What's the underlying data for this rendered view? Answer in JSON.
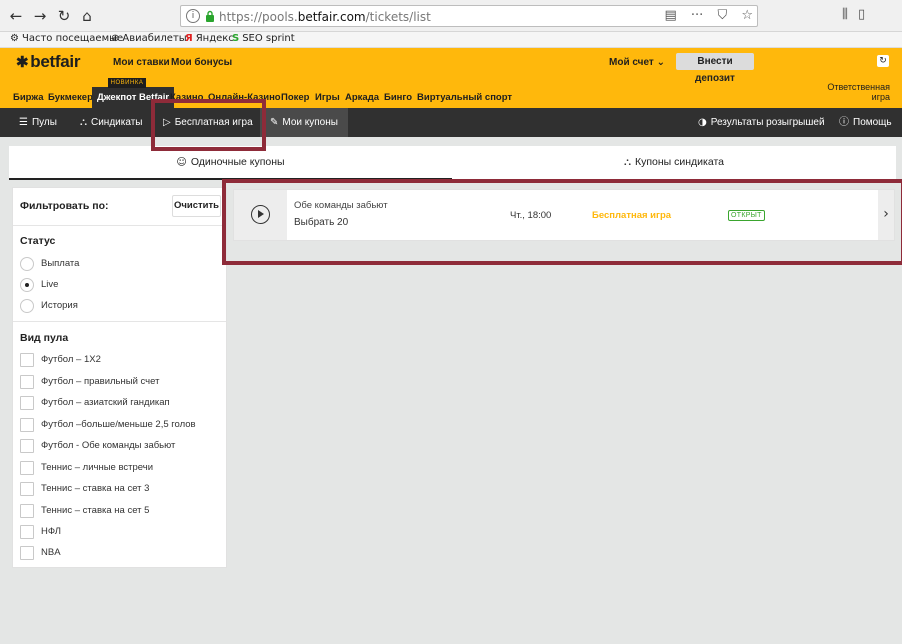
{
  "browser": {
    "url_prefix": "https://pools.",
    "url_domain": "betfair.com",
    "url_path": "/tickets/list",
    "bookmarks": [
      {
        "label": "Часто посещаемые",
        "icon": "gear-icon"
      },
      {
        "label": "Авиабилеты",
        "icon": "globe-icon"
      },
      {
        "label": "Яндекс",
        "icon": "yandex-icon"
      },
      {
        "label": "SEO sprint",
        "icon": "seo-icon"
      }
    ]
  },
  "header": {
    "logo": "betfair",
    "top_links": [
      "Мои ставки",
      "Мои бонусы"
    ],
    "account": "Мой счет",
    "deposit": "Внести депозит",
    "new_badge": "НОВИНКА",
    "responsible_line1": "Ответственная",
    "responsible_line2": "игра",
    "product_nav": [
      "Биржа",
      "Букмекер",
      "Джекпот Betfair",
      "Казино",
      "Онлайн-Казино",
      "Покер",
      "Игры",
      "Аркада",
      "Бинго",
      "Виртуальный спорт"
    ],
    "brand_color": "#ffb80c"
  },
  "subnav": {
    "pools": "Пулы",
    "syndicates": "Синдикаты",
    "free_game": "Бесплатная игра",
    "my_coupons": "Мои купоны",
    "results": "Результаты розыгрышей",
    "help": "Помощь"
  },
  "tabs": {
    "single": "Одиночные купоны",
    "syndicate": "Купоны синдиката"
  },
  "filter": {
    "title": "Фильтровать по:",
    "clear": "Очистить",
    "status_title": "Статус",
    "status_options": [
      "Выплата",
      "Live",
      "История"
    ],
    "status_selected": "Live",
    "pool_type_title": "Вид пула",
    "pool_types": [
      "Футбол – 1X2",
      "Футбол – правильный счет",
      "Футбол – азиатский гандикап",
      "Футбол –больше/меньше 2,5 голов",
      "Футбол - Обе команды забьют",
      "Теннис – личные встречи",
      "Теннис – ставка на сет 3",
      "Теннис – ставка на сет 5",
      "НФЛ",
      "NBA"
    ]
  },
  "coupon": {
    "name": "Обе команды забьют",
    "pick": "Выбрать 20",
    "time": "Чт., 18:00",
    "type": "Бесплатная игра",
    "status": "ОТКРЫТ"
  }
}
